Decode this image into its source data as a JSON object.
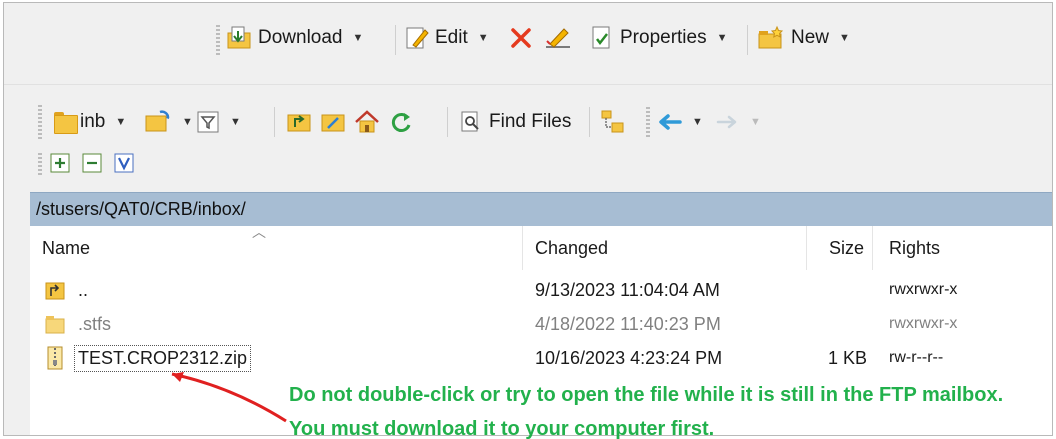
{
  "toolbar_top": {
    "download_label": "Download",
    "edit_label": "Edit",
    "properties_label": "Properties",
    "new_label": "New"
  },
  "toolbar_nav": {
    "location_label": "inb",
    "find_files_label": "Find Files"
  },
  "path": "/stusers/QAT0/CRB/inbox/",
  "columns": {
    "name": "Name",
    "changed": "Changed",
    "size": "Size",
    "rights": "Rights"
  },
  "files": [
    {
      "name": "..",
      "changed": "9/13/2023 11:04:04 AM",
      "size": "",
      "rights": "rwxrwxr-x",
      "icon": "parent-folder-icon"
    },
    {
      "name": ".stfs",
      "changed": "4/18/2022 11:40:23 PM",
      "size": "",
      "rights": "rwxrwxr-x",
      "icon": "folder-icon"
    },
    {
      "name": "TEST.CROP2312.zip",
      "changed": "10/16/2023 4:23:24 PM",
      "size": "1 KB",
      "rights": "rw-r--r--",
      "icon": "zip-file-icon"
    }
  ],
  "annotation": {
    "line1": "Do not double-click or try to open the file while it is still in the FTP mailbox.",
    "line2": "You must download it to your computer first."
  },
  "colors": {
    "annotation_text": "#22b14c",
    "annotation_arrow": "#e02020",
    "path_bar": "#a7bdd3"
  }
}
